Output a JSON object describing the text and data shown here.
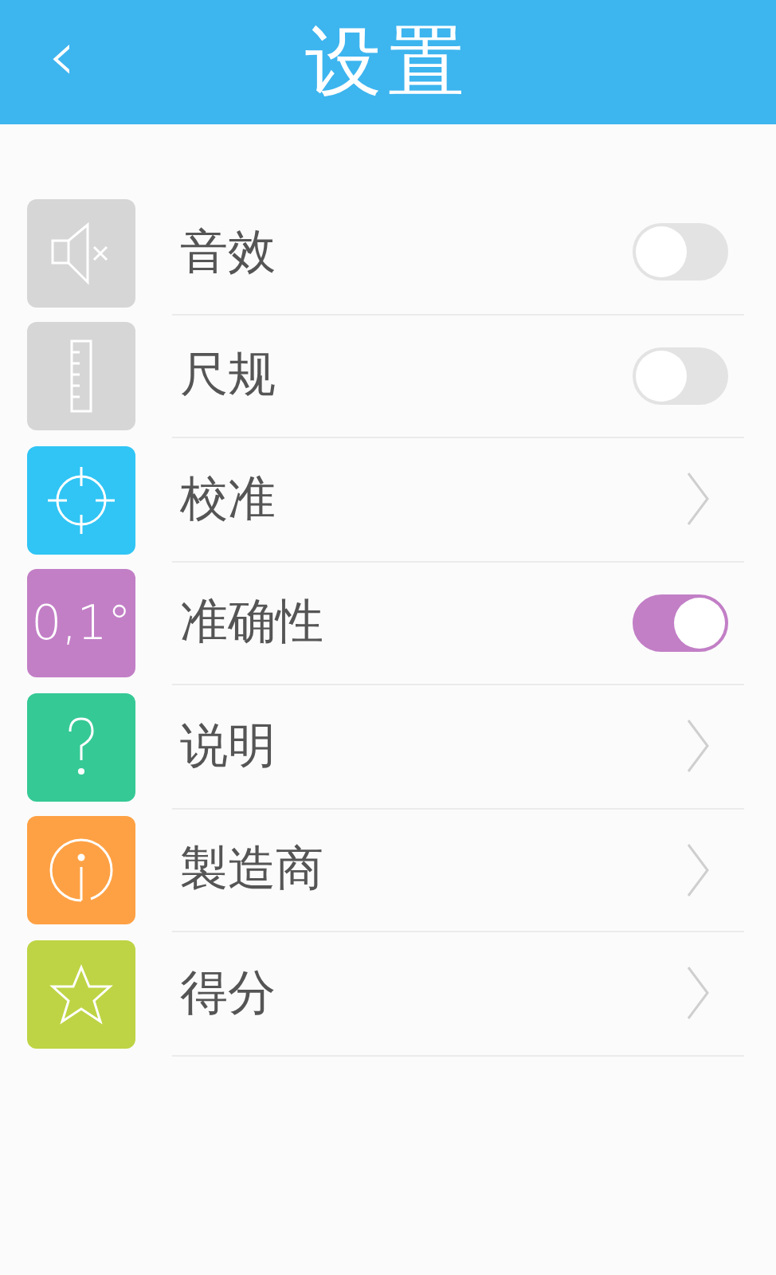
{
  "header": {
    "back": "‹",
    "title": "设置"
  },
  "items": [
    {
      "label": "音效",
      "kind": "toggle",
      "on": false,
      "color": "#d6d6d6"
    },
    {
      "label": "尺规",
      "kind": "toggle",
      "on": false,
      "color": "#d6d6d6"
    },
    {
      "label": "校准",
      "kind": "link",
      "color": "#30c5f5"
    },
    {
      "label": "准确性",
      "kind": "toggle",
      "on": true,
      "color": "#c27fc6",
      "icon_text": "0,1°"
    },
    {
      "label": "说明",
      "kind": "link",
      "color": "#35c995"
    },
    {
      "label": "製造商",
      "kind": "link",
      "color": "#fea144"
    },
    {
      "label": "得分",
      "kind": "link",
      "color": "#bed444"
    }
  ]
}
